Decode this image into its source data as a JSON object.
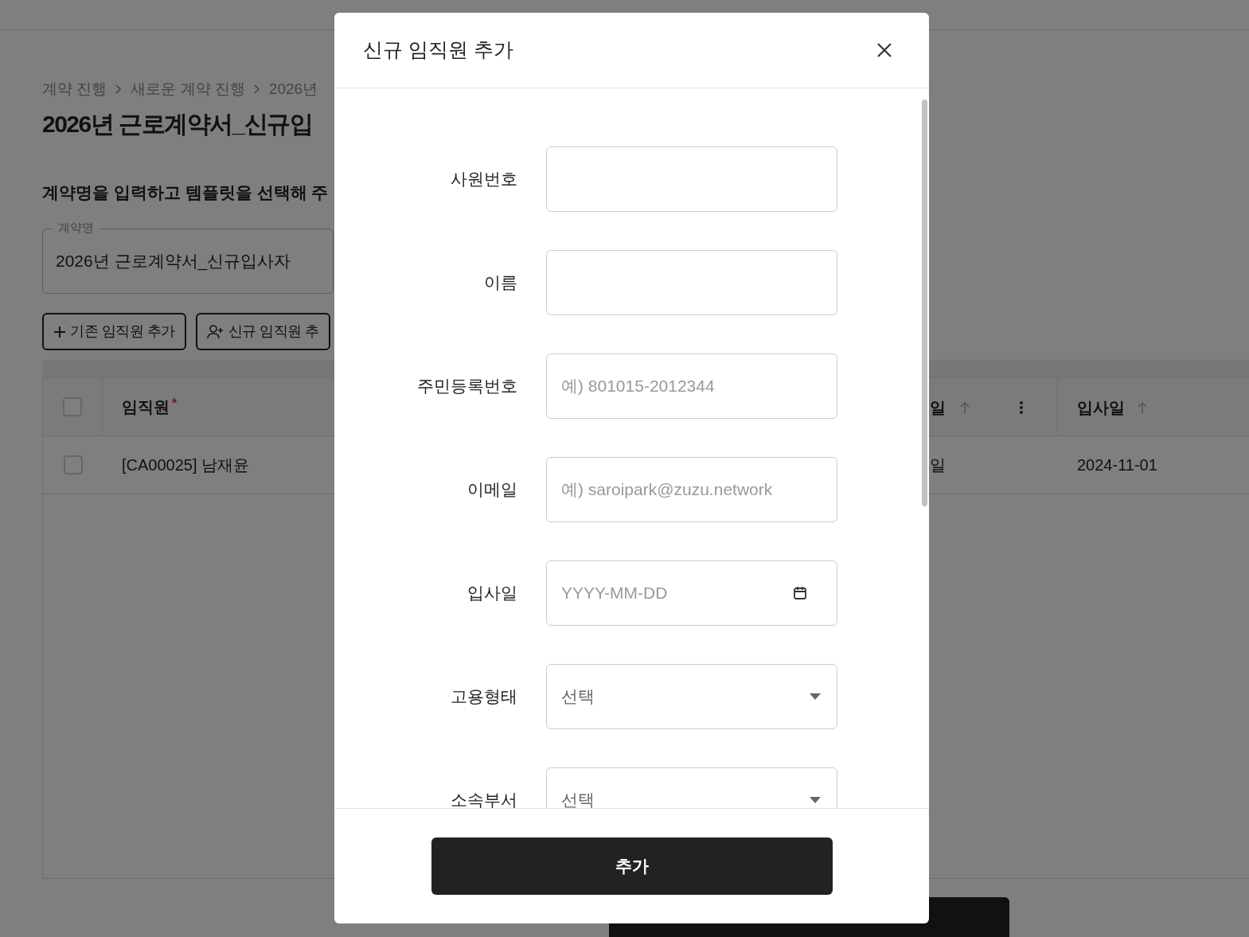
{
  "page": {
    "breadcrumb": [
      "계약 진행",
      "새로운 계약 진행",
      "2026년"
    ],
    "title": "2026년 근로계약서_신규입",
    "subtitle": "계약명을 입력하고 템플릿을 선택해 주",
    "contract_name": {
      "label": "계약명",
      "value": "2026년 근로계약서_신규입사자"
    },
    "buttons": [
      {
        "kind": "plus",
        "label": "기존 임직원 추가"
      },
      {
        "kind": "person",
        "label": "신규 임직원 추"
      }
    ],
    "table": {
      "all_checked": false,
      "required_symbol": "*",
      "columns": [
        {
          "label": "임직원",
          "required": true
        },
        {
          "label": "일",
          "required": false
        },
        {
          "label": "입사일",
          "required": false
        }
      ],
      "rows": [
        {
          "checked": false,
          "cells": [
            "[CA00025] 남재윤",
            "일",
            "2024-11-01"
          ]
        }
      ]
    }
  },
  "dialog": {
    "title": "신규 임직원 추가",
    "fields": [
      {
        "kind": "text",
        "label": "사원번호"
      },
      {
        "kind": "text",
        "label": "이름"
      },
      {
        "kind": "text",
        "label": "주민등록번호",
        "placeholder": "예) 801015-2012344"
      },
      {
        "kind": "text",
        "label": "이메일",
        "placeholder": "예) saroipark@zuzu.network"
      },
      {
        "kind": "date",
        "label": "입사일",
        "placeholder": "YYYY-MM-DD"
      },
      {
        "kind": "select",
        "label": "고용형태",
        "value": "선택"
      },
      {
        "kind": "select",
        "label": "소속부서",
        "value": "선택"
      }
    ],
    "submit": "추가"
  }
}
